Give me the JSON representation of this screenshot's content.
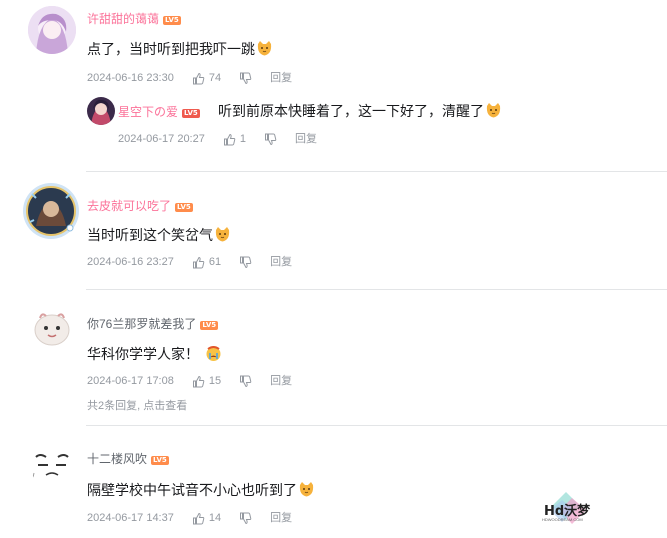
{
  "comments": [
    {
      "username": "许甜甜的蔼蔼",
      "level": "LV5",
      "text": "点了，当时听到把我吓一跳",
      "date": "2024-06-16 23:30",
      "likes": "74",
      "reply_label": "回复",
      "reply": {
        "username": "星空下の爱",
        "level": "LV5",
        "text": "听到前原本快睡着了，这一下好了，清醒了",
        "date": "2024-06-17 20:27",
        "likes": "1",
        "reply_label": "回复"
      }
    },
    {
      "username": "去皮就可以吃了",
      "level": "LV5",
      "text": "当时听到这个笑岔气",
      "date": "2024-06-16 23:27",
      "likes": "61",
      "reply_label": "回复"
    },
    {
      "username": "你76兰那罗就差我了",
      "level": "LV5",
      "text": "华科你学学人家！",
      "date": "2024-06-17 17:08",
      "likes": "15",
      "reply_label": "回复",
      "more_replies": "共2条回复, 点击查看"
    },
    {
      "username": "十二楼风吹",
      "level": "LV5",
      "text": "隔壁学校中午试音不小心也听到了",
      "date": "2024-06-17 14:37",
      "likes": "14",
      "reply_label": "回复"
    }
  ],
  "watermark": {
    "text": "Hd沃梦",
    "sub": "HDWOODREAM.COM"
  },
  "colors": {
    "pink_name": "#fb7299",
    "gray_name": "#61666d",
    "meta": "#9499a0",
    "level_badge": "#ff8c4b"
  }
}
